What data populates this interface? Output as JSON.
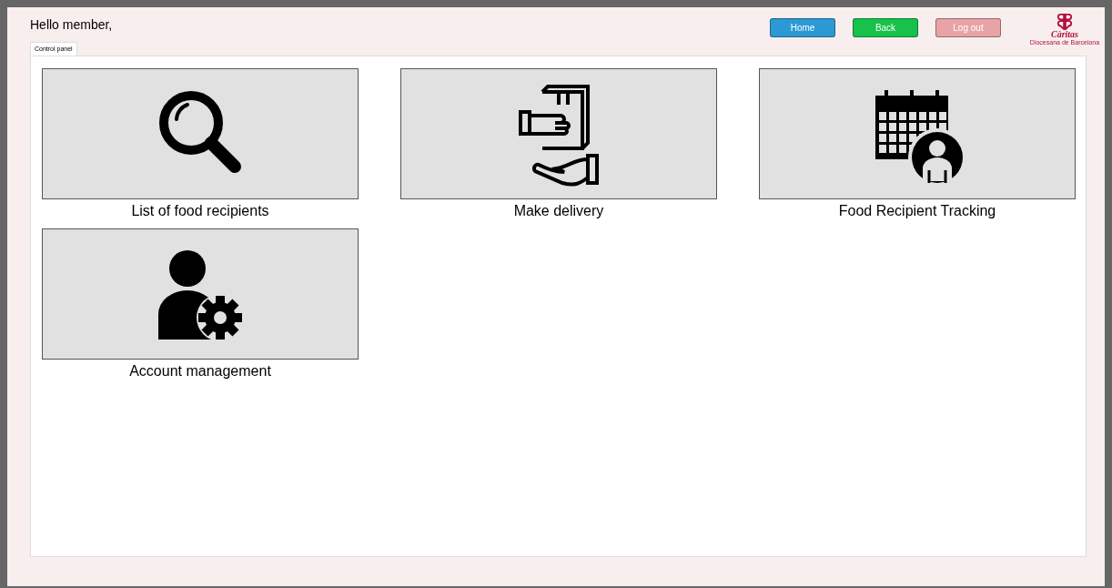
{
  "greeting": "Hello member,",
  "buttons": [
    {
      "label": "Home",
      "color": "#2b9ad4"
    },
    {
      "label": "Back",
      "color": "#16c24a"
    },
    {
      "label": "Log out",
      "color": "#e8a3a6"
    }
  ],
  "logo": {
    "name": "Càritas",
    "subtitle": "Diocesana de Barcelona"
  },
  "tabs": [
    {
      "label": "Control panel",
      "selected": true
    }
  ],
  "tiles": [
    {
      "kind": "search",
      "label": "List of food recipients"
    },
    {
      "kind": "delivery",
      "label": "Make delivery"
    },
    {
      "kind": "calendar-user",
      "label": "Food Recipient Tracking"
    },
    {
      "kind": "user-gear",
      "label": "Account management"
    }
  ]
}
